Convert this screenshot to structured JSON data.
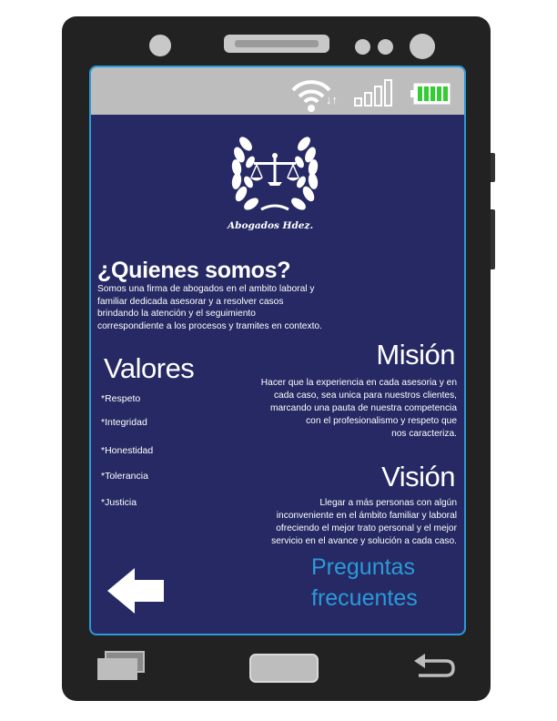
{
  "status_bar": {
    "icons": [
      "wifi-icon",
      "signal-icon",
      "battery-icon"
    ],
    "data_arrows": "↓↑"
  },
  "logo": {
    "firm_name": "Abogados Hdez."
  },
  "about": {
    "title": "¿Quienes somos?",
    "lines": [
      "Somos una firma de abogados en el ambito laboral y",
      "familiar dedicada  asesorar y a resolver casos",
      "brindando la atención y el seguimiento",
      "correspondiente a los procesos y tramites en contexto."
    ]
  },
  "values": {
    "title": "Valores",
    "items": [
      "*Respeto",
      "*Integridad",
      "*Honestidad",
      "*Tolerancia",
      "*Justicia"
    ]
  },
  "mission": {
    "title": "Misión",
    "lines": [
      "Hacer que la experiencia en cada asesoria y en",
      "cada caso, sea unica para nuestros clientes,",
      "marcando una pauta de nuestra competencia",
      "con el profesionalismo y respeto que",
      "nos caracteriza."
    ]
  },
  "vision": {
    "title": "Visión",
    "lines": [
      "Llegar a más personas con algún",
      "inconveniente en el ámbito familiar y laboral",
      "ofreciendo el mejor trato personal y el mejor",
      "servicio en el avance y solución a cada caso."
    ]
  },
  "faq": {
    "line1": "Preguntas",
    "line2": "frecuentes"
  },
  "colors": {
    "screen_bg": "#262963",
    "accent": "#2b9ad8",
    "battery": "#33cc33",
    "phone_body": "#222222"
  }
}
